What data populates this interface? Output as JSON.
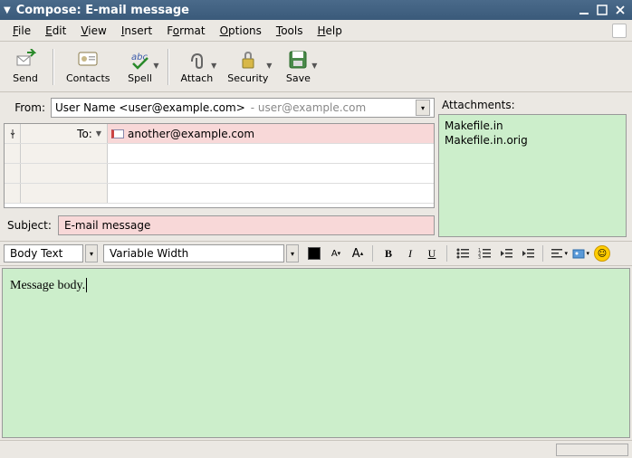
{
  "titlebar": {
    "title": "Compose: E-mail message"
  },
  "menubar": {
    "file": "File",
    "edit": "Edit",
    "view": "View",
    "insert": "Insert",
    "format": "Format",
    "options": "Options",
    "tools": "Tools",
    "help": "Help"
  },
  "toolbar": {
    "send": "Send",
    "contacts": "Contacts",
    "spell": "Spell",
    "attach": "Attach",
    "security": "Security",
    "save": "Save"
  },
  "from": {
    "label": "From:",
    "value": "User Name <user@example.com>",
    "identity": "- user@example.com"
  },
  "recipients": {
    "to_label": "To:",
    "rows": [
      {
        "type": "To:",
        "value": "another@example.com"
      },
      {
        "type": "",
        "value": ""
      },
      {
        "type": "",
        "value": ""
      },
      {
        "type": "",
        "value": ""
      }
    ]
  },
  "subject": {
    "label": "Subject:",
    "value": "E-mail message"
  },
  "attachments": {
    "label": "Attachments:",
    "items": [
      "Makefile.in",
      "Makefile.in.orig"
    ]
  },
  "format": {
    "paragraph": "Body Text",
    "font": "Variable Width"
  },
  "body": "Message body."
}
